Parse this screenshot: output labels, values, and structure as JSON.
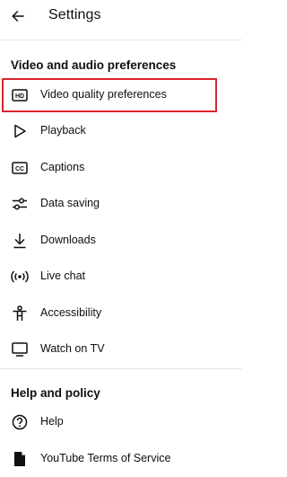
{
  "header": {
    "title": "Settings",
    "back_icon": "arrow-left-icon"
  },
  "sections": [
    {
      "title": "Video and audio preferences",
      "items": [
        {
          "label": "Video quality preferences",
          "icon": "hd-icon",
          "highlighted": true
        },
        {
          "label": "Playback",
          "icon": "play-outline-icon"
        },
        {
          "label": "Captions",
          "icon": "captions-icon"
        },
        {
          "label": "Data saving",
          "icon": "sliders-icon"
        },
        {
          "label": "Downloads",
          "icon": "download-icon"
        },
        {
          "label": "Live chat",
          "icon": "live-broadcast-icon"
        },
        {
          "label": "Accessibility",
          "icon": "accessibility-person-icon"
        },
        {
          "label": "Watch on TV",
          "icon": "tv-icon"
        }
      ]
    },
    {
      "title": "Help and policy",
      "items": [
        {
          "label": "Help",
          "icon": "help-circle-icon"
        },
        {
          "label": "YouTube Terms of Service",
          "icon": "document-icon"
        }
      ]
    }
  ],
  "colors": {
    "highlight_border": "#d9262c",
    "text": "#0f0f0f",
    "divider": "#e5e5e5"
  }
}
